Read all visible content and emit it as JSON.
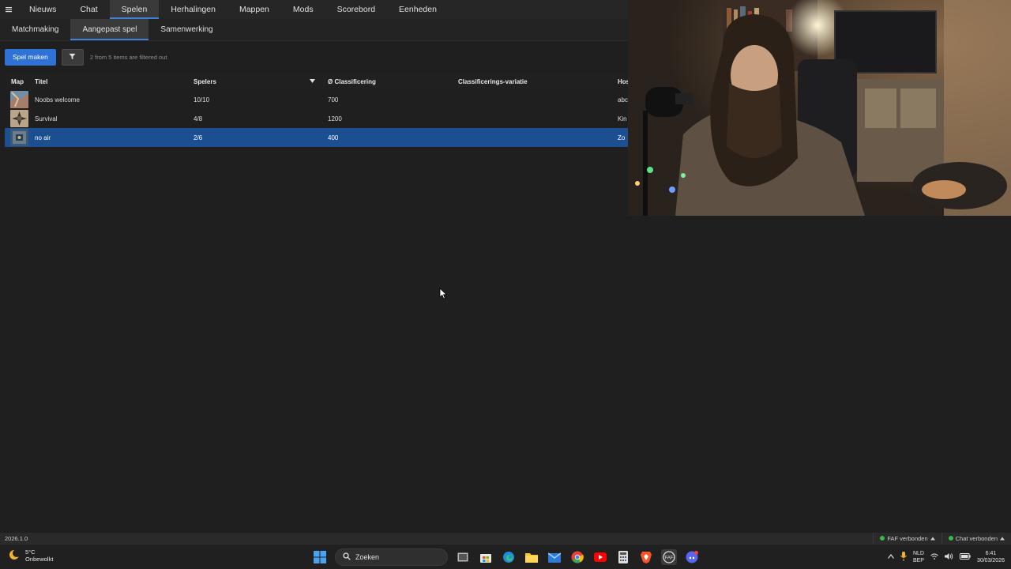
{
  "menu": {
    "icon": "hamburger-icon",
    "items": [
      "Nieuws",
      "Chat",
      "Spelen",
      "Herhalingen",
      "Mappen",
      "Mods",
      "Scorebord",
      "Eenheden"
    ],
    "active_index": 2
  },
  "subtabs": {
    "items": [
      "Matchmaking",
      "Aangepast spel",
      "Samenwerking"
    ],
    "active_index": 1
  },
  "toolbar": {
    "create_label": "Spel maken",
    "filter_icon": "funnel-icon",
    "filter_note": "2 from 5 items are filtered out"
  },
  "table": {
    "headers": {
      "map": "Map",
      "title": "Titel",
      "players": "Spelers",
      "rating": "Ø Classificering",
      "deviation": "Classificerings-variatie",
      "host": "Host"
    },
    "rows": [
      {
        "title": "Noobs welcome",
        "players": "10/10",
        "rating": "700",
        "deviation": "",
        "host": "abc"
      },
      {
        "title": "Survival",
        "players": "4/8",
        "rating": "1200",
        "deviation": "",
        "host": "Kin"
      },
      {
        "title": "no air",
        "players": "2/6",
        "rating": "400",
        "deviation": "",
        "host": "Zo"
      }
    ],
    "selected_index": 2
  },
  "statusbar": {
    "version": "2026.1.0",
    "faf_status": "FAF verbonden",
    "chat_status": "Chat verbonden",
    "status_color": "#3ab54a"
  },
  "taskbar": {
    "weather_temp": "5°C",
    "weather_desc": "Onbewolkt",
    "search_placeholder": "Zoeken",
    "lang_top": "NLD",
    "lang_bottom": "BEP",
    "time": "6:41",
    "date": "30/03/2026"
  },
  "colors": {
    "accent": "#2f72d6",
    "selection": "#1c4f91",
    "background": "#1f1f1f"
  }
}
